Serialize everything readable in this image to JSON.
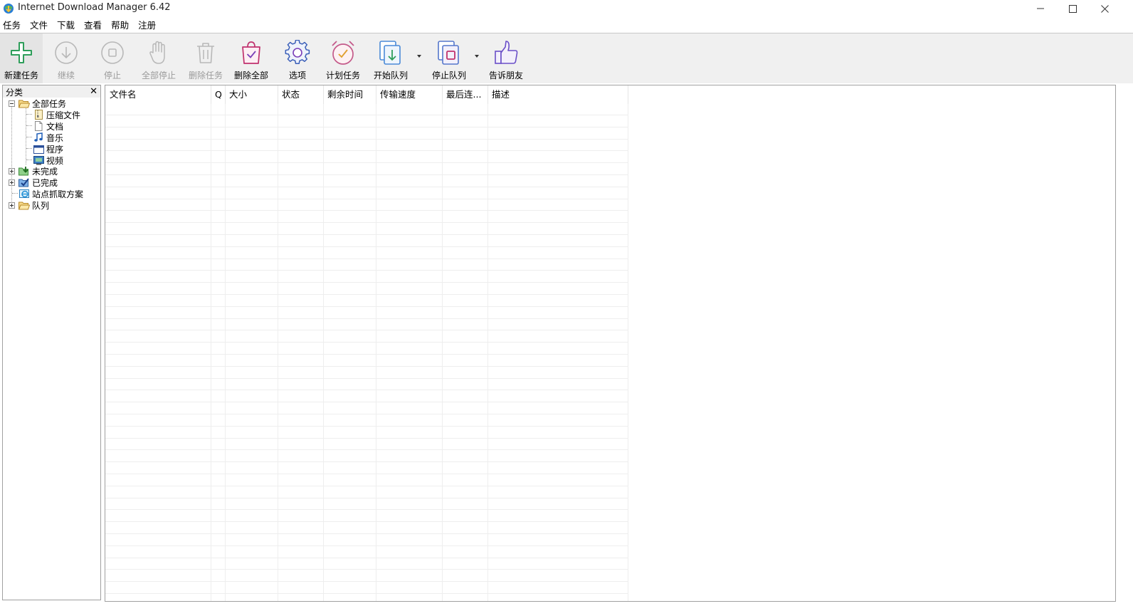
{
  "window": {
    "title": "Internet Download Manager 6.42"
  },
  "menu": [
    "任务",
    "文件",
    "下载",
    "查看",
    "帮助",
    "注册"
  ],
  "toolbar": {
    "add": "新建任务",
    "resume": "继续",
    "stop": "停止",
    "stop_all": "全部停止",
    "delete": "删除任务",
    "delete_all": "删除全部",
    "options": "选项",
    "scheduler": "计划任务",
    "start_queue": "开始队列",
    "stop_queue": "停止队列",
    "tell_friend": "告诉朋友"
  },
  "categories": {
    "title": "分类",
    "close": "✕",
    "all": "全部任务",
    "compressed": "压缩文件",
    "documents": "文档",
    "music": "音乐",
    "programs": "程序",
    "video": "视频",
    "unfinished": "未完成",
    "finished": "已完成",
    "grabber": "站点抓取方案",
    "queues": "队列"
  },
  "columns": {
    "filename": "文件名",
    "q": "Q",
    "size": "大小",
    "status": "状态",
    "time_left": "剩余时间",
    "speed": "传输速度",
    "last_try": "最后连...",
    "description": "描述"
  },
  "colors": {
    "accent_green": "#2e9e5a",
    "accent_blue": "#3b7fd6",
    "accent_magenta": "#c0316d",
    "disabled": "#b8b8b8"
  }
}
